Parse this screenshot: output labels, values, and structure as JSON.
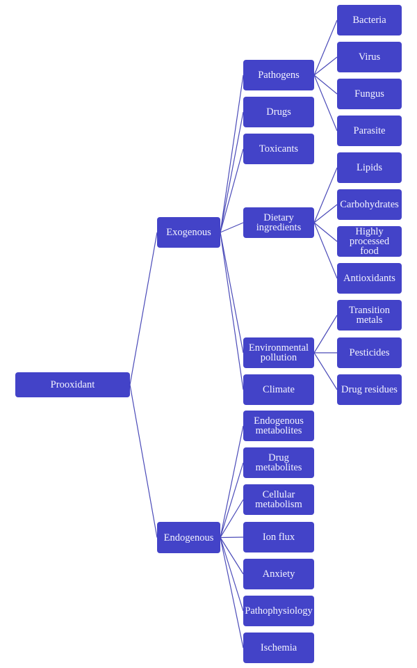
{
  "diagram": {
    "type": "tree",
    "colors": {
      "node_fill": "#4343c8",
      "node_text": "#f4f4ff",
      "link": "#4a4ab8",
      "background": "#ffffff"
    },
    "root": {
      "label": "Prooxidant",
      "children": [
        {
          "label": "Exogenous",
          "children": [
            {
              "label": "Pathogens",
              "children": [
                {
                  "label": "Bacteria"
                },
                {
                  "label": "Virus"
                },
                {
                  "label": "Fungus"
                },
                {
                  "label": "Parasite"
                }
              ]
            },
            {
              "label": "Drugs"
            },
            {
              "label": "Toxicants"
            },
            {
              "label": "Dietary\ningredients",
              "children": [
                {
                  "label": "Lipids"
                },
                {
                  "label": "Carbohydrates"
                },
                {
                  "label": "Highly\nprocessed\nfood"
                },
                {
                  "label": "Antioxidants"
                }
              ]
            },
            {
              "label": "Environmental\npollution",
              "children": [
                {
                  "label": "Transition\nmetals"
                },
                {
                  "label": "Pesticides"
                },
                {
                  "label": "Drug residues"
                }
              ]
            },
            {
              "label": "Climate"
            }
          ]
        },
        {
          "label": "Endogenous",
          "children": [
            {
              "label": "Endogenous\nmetabolites"
            },
            {
              "label": "Drug\nmetabolites"
            },
            {
              "label": "Cellular\nmetabolism"
            },
            {
              "label": "Ion flux"
            },
            {
              "label": "Anxiety"
            },
            {
              "label": "Pathophysiology"
            },
            {
              "label": "Ischemia"
            }
          ]
        }
      ]
    }
  }
}
